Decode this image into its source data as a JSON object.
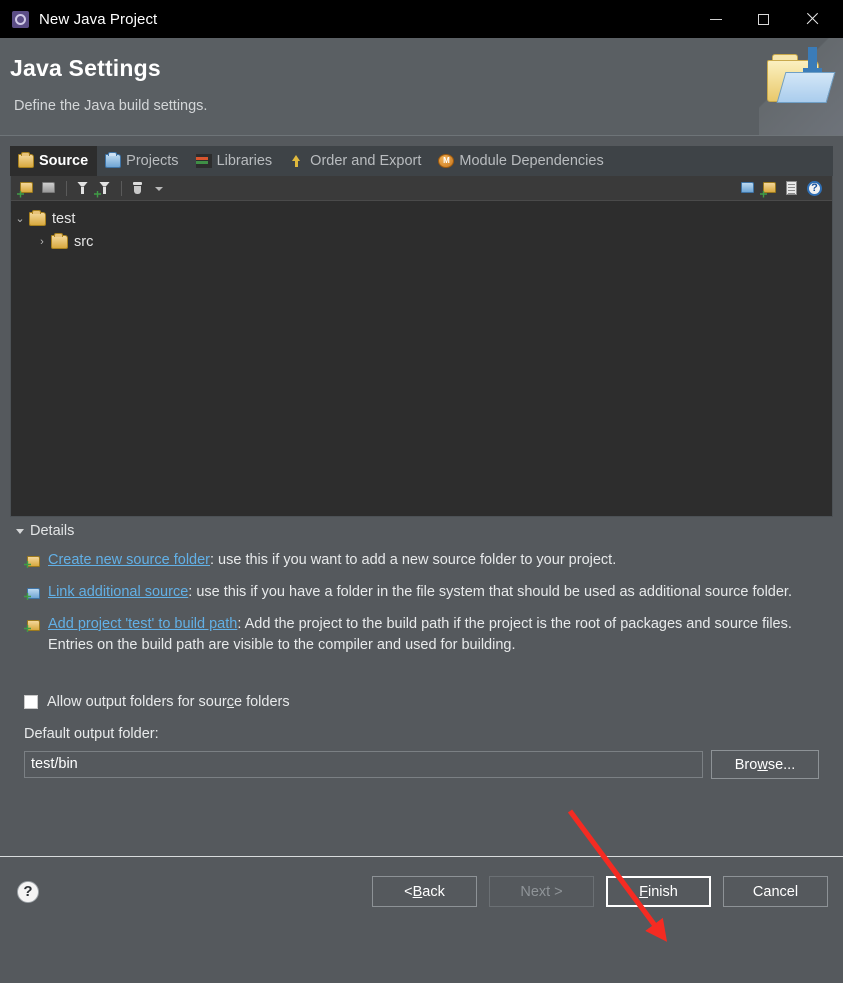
{
  "window": {
    "title": "New Java Project",
    "icon": "java-project-icon",
    "minimize_label": "Minimize",
    "maximize_label": "Maximize",
    "close_label": "Close"
  },
  "banner": {
    "title": "Java Settings",
    "subtitle": "Define the Java build settings.",
    "art_icon": "folder-with-import-arrow-icon"
  },
  "tabs": [
    {
      "label": "Source",
      "icon": "source-folder-icon",
      "selected": true
    },
    {
      "label": "Projects",
      "icon": "projects-folder-icon",
      "selected": false
    },
    {
      "label": "Libraries",
      "icon": "libraries-books-icon",
      "selected": false
    },
    {
      "label": "Order and Export",
      "icon": "order-export-arrows-icon",
      "selected": false
    },
    {
      "label": "Module Dependencies",
      "icon": "module-dependencies-icon",
      "selected": false
    }
  ],
  "tree_toolbar": {
    "left": [
      {
        "icon": "add-folder-icon",
        "name": "add-source-folder-button"
      },
      {
        "icon": "link-folder-icon",
        "name": "link-source-folder-button"
      },
      {
        "icon": "filter-icon",
        "name": "edit-filter-button"
      },
      {
        "icon": "filter-add-icon",
        "name": "add-filter-button"
      },
      {
        "icon": "jar-icon",
        "name": "configure-output-button"
      },
      {
        "icon": "chevron-down-icon",
        "name": "toolbar-dropdown-button"
      }
    ],
    "right": [
      {
        "icon": "link-additional-source-icon",
        "name": "link-additional-source-button"
      },
      {
        "icon": "add-folder-badge-icon",
        "name": "create-new-source-folder-button"
      },
      {
        "icon": "remove-document-icon",
        "name": "remove-entry-button"
      },
      {
        "icon": "help-icon",
        "name": "toolbar-help-button"
      }
    ]
  },
  "tree": [
    {
      "label": "test",
      "icon": "project-source-folder-icon",
      "twisty": "⌄",
      "expanded": true,
      "level": 0
    },
    {
      "label": "src",
      "icon": "source-folder-icon",
      "twisty": "›",
      "expanded": false,
      "level": 1
    }
  ],
  "details": {
    "header": "Details",
    "items": [
      {
        "icon": "create-new-source-folder-icon",
        "link": "Create new source folder",
        "text": ": use this if you want to add a new source folder to your project."
      },
      {
        "icon": "link-additional-source-icon",
        "link": "Link additional source",
        "text": ": use this if you have a folder in the file system that should be used as additional source folder."
      },
      {
        "icon": "add-project-to-build-path-icon",
        "link": "Add project 'test' to build path",
        "text": ": Add the project to the build path if the project is the root of packages and source files. Entries on the build path are visible to the compiler and used for building."
      }
    ]
  },
  "options": {
    "allow_output_folders_pre": "Allow output folders for sour",
    "allow_output_folders_mnemonic": "c",
    "allow_output_folders_post": "e folders",
    "allow_output_folders_checked": false,
    "default_output_folder_label": "Default output folder:",
    "default_output_folder_value": "test/bin",
    "default_output_folder_placeholder": "",
    "browse_pre": "Bro",
    "browse_mnemonic": "w",
    "browse_post": "se..."
  },
  "footer": {
    "help_label": "?",
    "back_pre": "< ",
    "back_mnemonic": "B",
    "back_post": "ack",
    "next_label": "Next >",
    "next_enabled": false,
    "finish_mnemonic": "F",
    "finish_post": "inish",
    "cancel_label": "Cancel"
  },
  "annotation": {
    "type": "red-arrow",
    "color": "#f52b22",
    "points_to": "finish-button"
  },
  "colors": {
    "dialog_bg": "#55595d",
    "titlebar_bg": "#000000",
    "tree_bg": "#2d2d2d",
    "tab_bg": "#3e4347",
    "link": "#62b0e6",
    "annotation": "#f52b22"
  }
}
